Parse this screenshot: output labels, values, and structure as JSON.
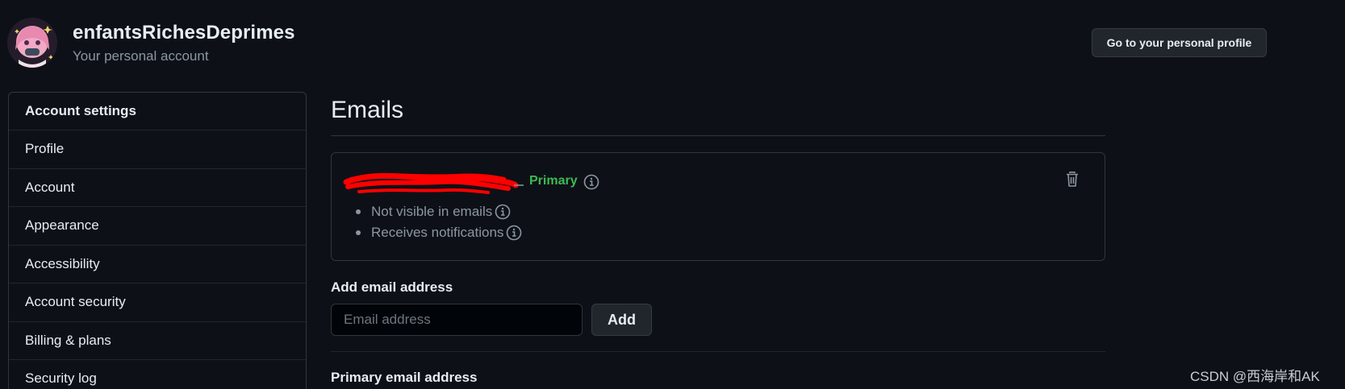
{
  "header": {
    "account_name": "enfantsRichesDeprimes",
    "account_subtitle": "Your personal account",
    "profile_button": "Go to your personal profile"
  },
  "sidebar": {
    "heading": "Account settings",
    "items": [
      {
        "label": "Profile"
      },
      {
        "label": "Account"
      },
      {
        "label": "Appearance"
      },
      {
        "label": "Accessibility"
      },
      {
        "label": "Account security"
      },
      {
        "label": "Billing & plans"
      },
      {
        "label": "Security log"
      }
    ]
  },
  "main": {
    "title": "Emails",
    "primary_badge": "Primary",
    "email_notes": [
      {
        "text": "Not visible in emails"
      },
      {
        "text": "Receives notifications"
      }
    ],
    "add_email_label": "Add email address",
    "email_input_placeholder": "Email address",
    "email_input_value": "",
    "add_button": "Add",
    "primary_email_heading": "Primary email address"
  },
  "watermark": "CSDN @西海岸和AK",
  "colors": {
    "background": "#0d1117",
    "border": "#30363d",
    "primary_green": "#3fb950",
    "muted_text": "#8d96a0",
    "redaction": "#ff0000"
  }
}
